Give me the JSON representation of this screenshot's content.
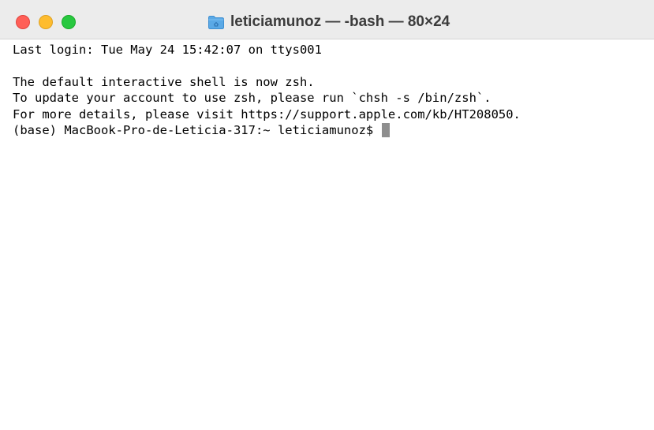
{
  "window": {
    "title": "leticiamunoz — -bash — 80×24",
    "title_icon": "home-folder-icon",
    "colors": {
      "close": "#ff5f57",
      "minimize": "#febc2e",
      "maximize": "#28c840",
      "folder": "#5aa9e6"
    }
  },
  "terminal": {
    "lines": [
      "Last login: Tue May 24 15:42:07 on ttys001",
      "",
      "The default interactive shell is now zsh.",
      "To update your account to use zsh, please run `chsh -s /bin/zsh`.",
      "For more details, please visit https://support.apple.com/kb/HT208050."
    ],
    "prompt": "(base) MacBook-Pro-de-Leticia-317:~ leticiamunoz$ "
  }
}
